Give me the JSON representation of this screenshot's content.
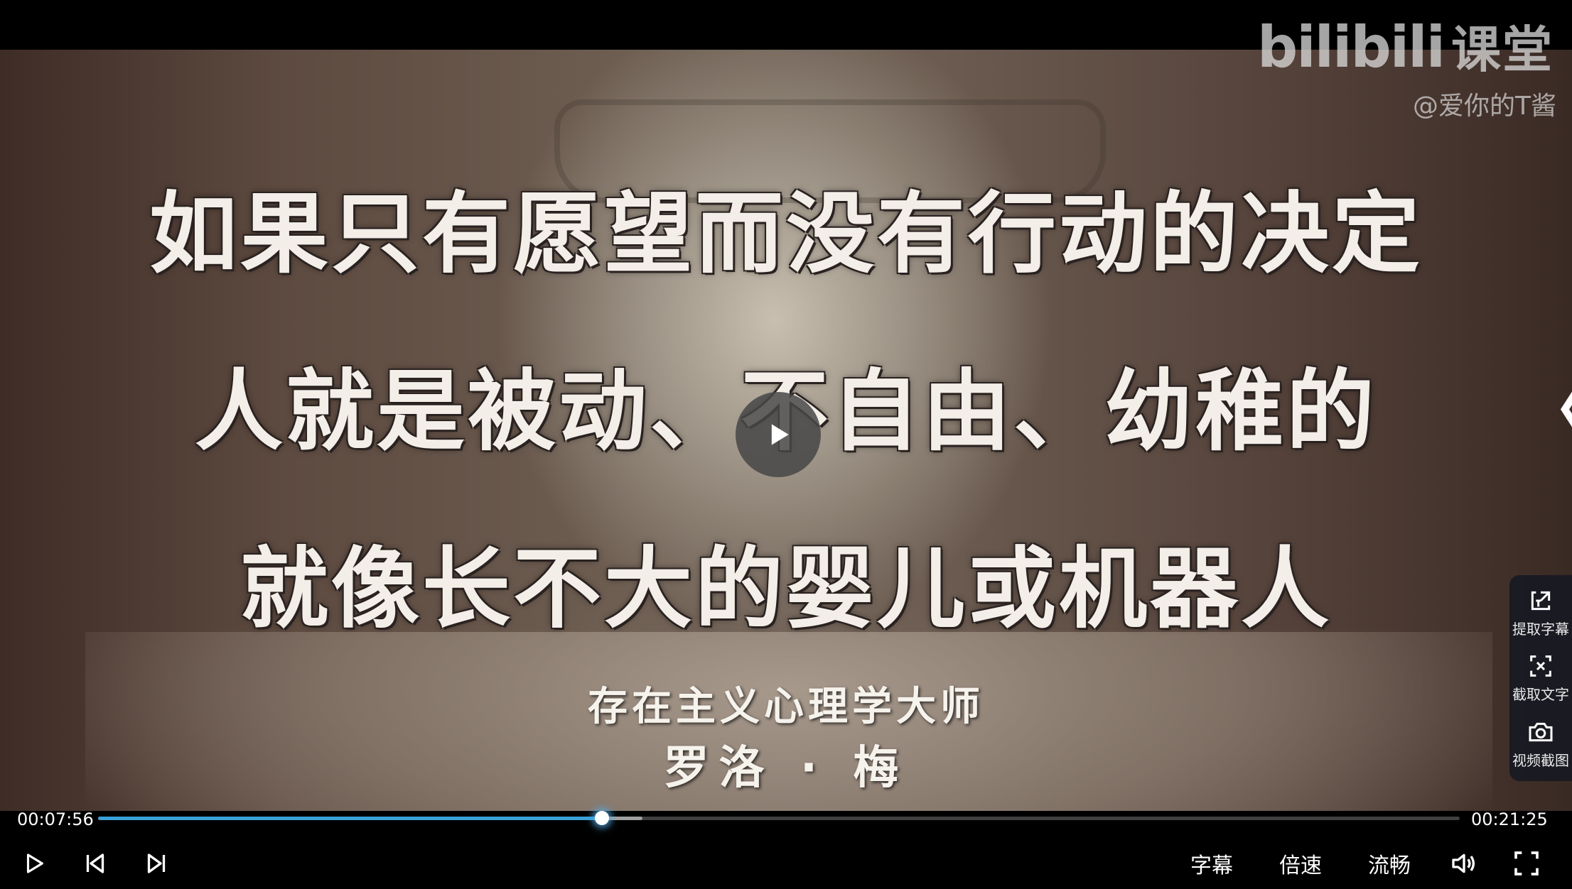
{
  "video": {
    "caption_lines": [
      "如果只有愿望而没有行动的决定",
      "人就是被动、不自由、幼稚的",
      "就像长不大的婴儿或机器人"
    ],
    "subtitle_lines": [
      "存在主义心理学大师",
      "罗洛 · 梅"
    ],
    "watermark": {
      "logo_text": "bilibili",
      "logo_suffix": "课堂",
      "uploader": "@爱你的T酱"
    }
  },
  "side_toggle": "❮",
  "tools": [
    {
      "label": "提取字幕",
      "icon": "extract-subtitle-icon"
    },
    {
      "label": "截取文字",
      "icon": "capture-text-icon"
    },
    {
      "label": "视频截图",
      "icon": "screenshot-camera-icon"
    }
  ],
  "progress": {
    "current_time": "00:07:56",
    "total_time": "00:21:25",
    "played_fraction": 0.37,
    "buffered_fraction": 0.4
  },
  "controls": {
    "play_icon": "play-icon",
    "prev_icon": "previous-icon",
    "next_icon": "next-icon",
    "subtitles_label": "字幕",
    "speed_label": "倍速",
    "quality_label": "流畅",
    "volume_icon": "volume-icon",
    "fullscreen_icon": "fullscreen-icon"
  },
  "colors": {
    "accent": "#3aa0d8",
    "panel_bg": "#141822"
  }
}
